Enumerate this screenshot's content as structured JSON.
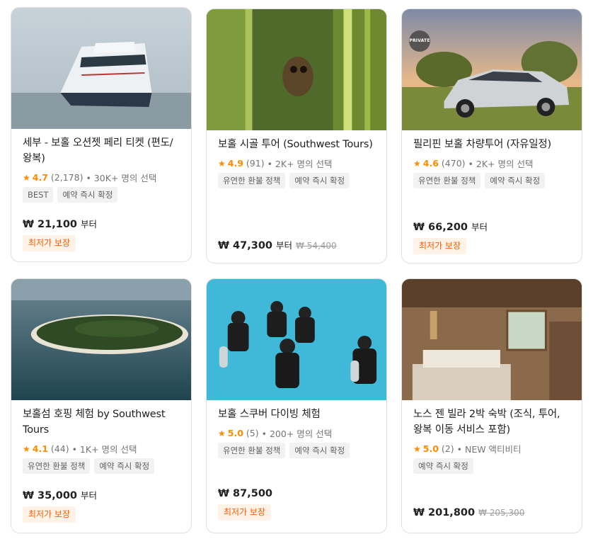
{
  "colors": {
    "accent": "#ff5b00",
    "star": "#ff8c00",
    "tag_bg": "#f2f2f2",
    "badge_bg": "#fff3e8"
  },
  "cards": [
    {
      "title": "세부 - 보홀 오션젯 페리 티켓 (편도/왕복)",
      "rating": "4.7",
      "reviews": "(2,178)",
      "sold": "• 30K+ 명의 선택",
      "tags": [
        "BEST",
        "예약 즉시 확정"
      ],
      "price": "₩ 21,100",
      "suffix": "부터",
      "original": "",
      "badge": "최저가 보장",
      "image": "ferry-boat"
    },
    {
      "title": "보홀 시골 투어 (Southwest Tours)",
      "rating": "4.9",
      "reviews": "(91)",
      "sold": "• 2K+ 명의 선택",
      "tags": [
        "유연한 환불 정책",
        "예약 즉시 확정"
      ],
      "price": "₩ 47,300",
      "suffix": "부터",
      "original": "₩ 54,400",
      "badge": "",
      "image": "tarsier-bamboo"
    },
    {
      "title": "필리핀 보홀 차량투어 (자유일정)",
      "rating": "4.6",
      "reviews": "(470)",
      "sold": "• 2K+ 명의 선택",
      "tags": [
        "유연한 환불 정책",
        "예약 즉시 확정"
      ],
      "price": "₩ 66,200",
      "suffix": "부터",
      "original": "",
      "badge": "최저가 보장",
      "image": "silver-car",
      "private_label": "PRIVATE"
    },
    {
      "title": "보홀섬 호핑 체험 by Southwest Tours",
      "rating": "4.1",
      "reviews": "(44)",
      "sold": "• 1K+ 명의 선택",
      "tags": [
        "유연한 환불 정책",
        "예약 즉시 확정"
      ],
      "price": "₩ 35,000",
      "suffix": "부터",
      "original": "",
      "badge": "최저가 보장",
      "image": "island-aerial"
    },
    {
      "title": "보홀 스쿠버 다이빙 체험",
      "rating": "5.0",
      "reviews": "(5)",
      "sold": "• 200+ 명의 선택",
      "tags": [
        "유연한 환불 정책",
        "예약 즉시 확정"
      ],
      "price": "₩ 87,500",
      "suffix": "",
      "original": "",
      "badge": "최저가 보장",
      "image": "scuba-pool"
    },
    {
      "title": "노스 젠 빌라 2박 숙박 (조식, 투어, 왕복 이동 서비스 포함)",
      "rating": "5.0",
      "reviews": "(2)",
      "sold": "• NEW 액티비티",
      "tags": [
        "예약 즉시 확정"
      ],
      "price": "₩ 201,800",
      "suffix": "",
      "original": "₩ 205,300",
      "badge": "",
      "image": "villa-bedroom"
    }
  ]
}
